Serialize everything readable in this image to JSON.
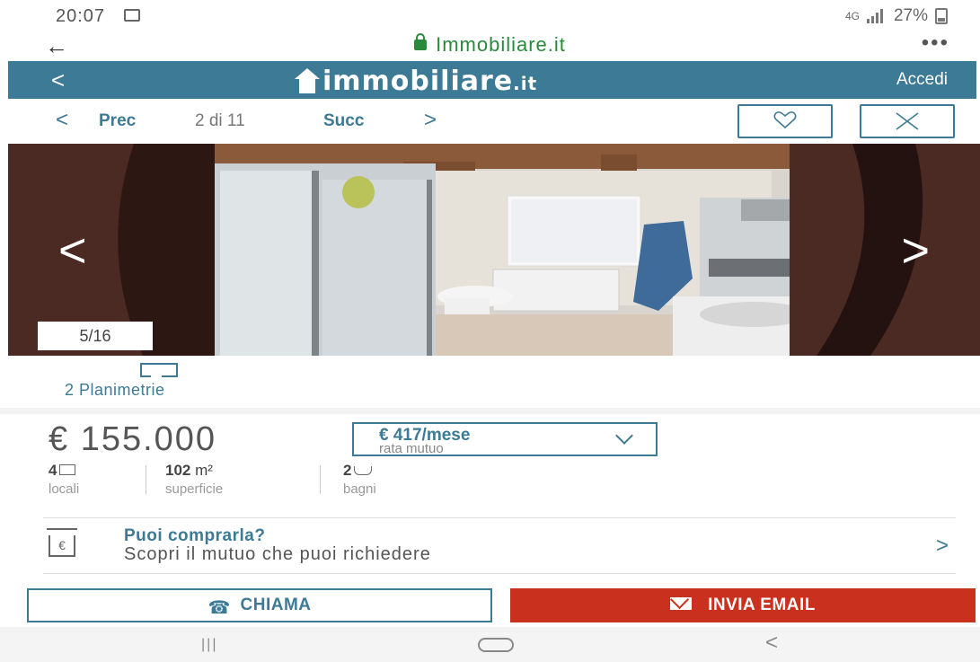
{
  "status_bar": {
    "time": "20:07",
    "network": "4G",
    "battery": "27%"
  },
  "browser": {
    "url": "Immobiliare.it"
  },
  "header": {
    "logo_text": "immobiliare",
    "logo_tld": ".it",
    "login_label": "Accedi"
  },
  "nav": {
    "prev_label": "Prec",
    "count": "2 di 11",
    "next_label": "Succ"
  },
  "photo": {
    "counter": "5/16"
  },
  "planimetrie": {
    "label": "2 Planimetrie"
  },
  "listing": {
    "price": "€ 155.000",
    "mortgage_value": "€ 417/mese",
    "mortgage_label": "rata mutuo",
    "features": [
      {
        "value": "4",
        "unit": "",
        "label": "locali"
      },
      {
        "value": "102",
        "unit": "m²",
        "label": "superficie"
      },
      {
        "value": "2",
        "unit": "",
        "label": "bagni"
      }
    ]
  },
  "promo": {
    "title": "Puoi comprarla?",
    "subtitle": "Scopri il mutuo che puoi richiedere"
  },
  "actions": {
    "call_label": "CHIAMA",
    "email_label": "INVIA EMAIL"
  },
  "colors": {
    "brand": "#3d7a95",
    "email_button": "#c9311e",
    "secure_url": "#2a8a3c"
  }
}
